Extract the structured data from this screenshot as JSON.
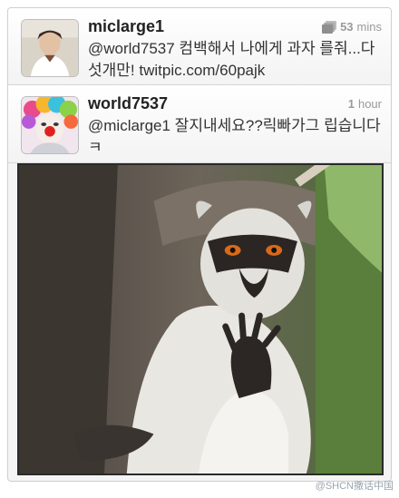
{
  "tweets": [
    {
      "username": "miclarge1",
      "time_value": "53",
      "time_unit": "mins",
      "text": "@world7537 컴백해서 나에게 과자 를줘...다섯개만! twitpic.com/60pajk",
      "icons": [
        "conversation-icon"
      ]
    },
    {
      "username": "world7537",
      "time_value": "1",
      "time_unit": "hour",
      "text": "@miclarge1 잘지내세요??릭빠가그 립습니다ㅋ"
    }
  ],
  "watermark": "@SHCN撒话中国",
  "colors": {
    "text": "#333333",
    "muted": "#9a9a9a",
    "border": "#cfcfcf"
  }
}
